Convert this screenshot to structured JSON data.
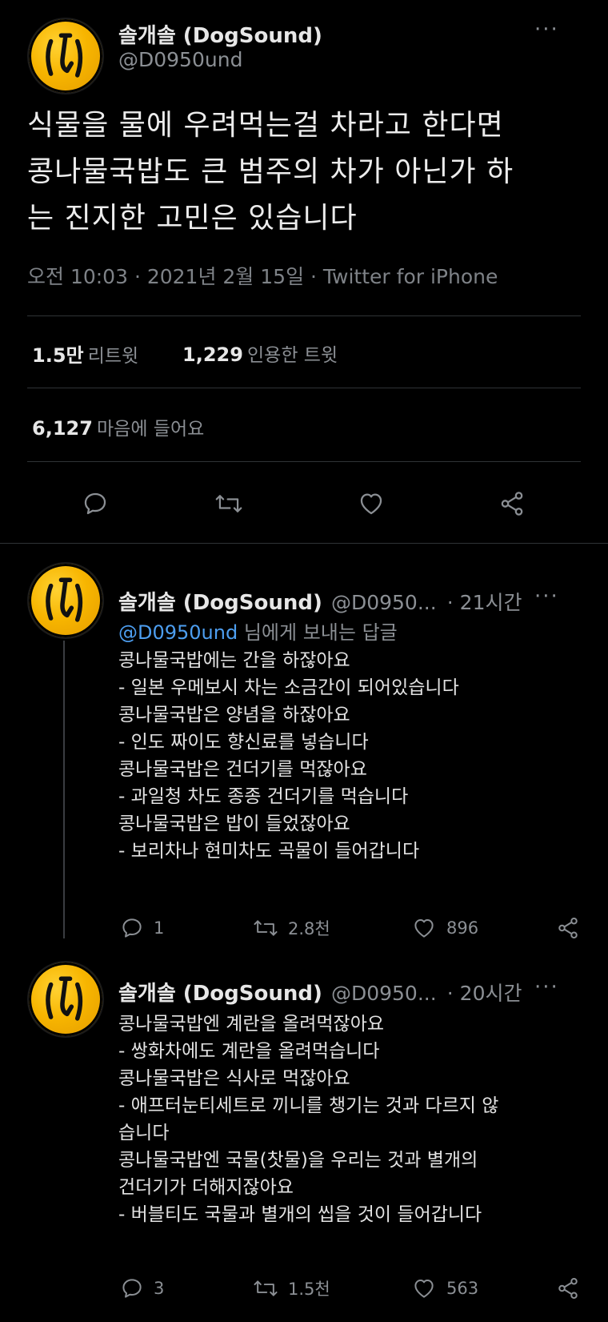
{
  "main_tweet": {
    "display_name": "솔개솔 (DogSound)",
    "handle": "@D0950und",
    "more": "···",
    "text_lines": [
      "식물을 물에 우려먹는걸 차라고 한다면",
      "콩나물국밥도 큰 범주의 차가 아닌가 하",
      "는 진지한 고민은 있습니다"
    ],
    "timestamp": "오전 10:03 · 2021년 2월 15일 · Twitter for iPhone",
    "stats": {
      "retweets_num": "1.5만",
      "retweets_label": "리트윗",
      "quotes_num": "1,229",
      "quotes_label": "인용한 트윗",
      "likes_num": "6,127",
      "likes_label": "마음에 들어요"
    }
  },
  "replies": [
    {
      "display_name": "솔개솔 (DogSound)",
      "handle": "@D0950...",
      "time": "· 21시간",
      "more": "···",
      "reply_to_handle": "@D0950und",
      "reply_to_suffix": " 님에게 보내는 답글",
      "lines": [
        "콩나물국밥에는 간을 하잖아요",
        "- 일본 우메보시 차는 소금간이 되어있습니다",
        "콩나물국밥은 양념을 하잖아요",
        "- 인도 짜이도 향신료를 넣습니다",
        "콩나물국밥은 건더기를 먹잖아요",
        "- 과일청 차도 종종 건더기를 먹습니다",
        "콩나물국밥은 밥이 들었잖아요",
        "- 보리차나 현미차도 곡물이 들어갑니다"
      ],
      "replies_count": "1",
      "retweets_count": "2.8천",
      "likes_count": "896"
    },
    {
      "display_name": "솔개솔 (DogSound)",
      "handle": "@D0950...",
      "time": "· 20시간",
      "more": "···",
      "lines": [
        "콩나물국밥엔 계란을 올려먹잖아요",
        "- 쌍화차에도 계란을 올려먹습니다",
        "콩나물국밥은 식사로 먹잖아요",
        "- 애프터눈티세트로 끼니를 챙기는 것과 다르지 않",
        "습니다",
        "콩나물국밥엔 국물(찻물)을 우리는 것과 별개의",
        "건더기가 더해지잖아요",
        "- 버블티도 국물과 별개의 씹을 것이 들어갑니다"
      ],
      "replies_count": "3",
      "retweets_count": "1.5천",
      "likes_count": "563"
    }
  ],
  "icons": {
    "reply": "speech-bubble-icon",
    "retweet": "retweet-icon",
    "like": "heart-icon",
    "share": "share-icon",
    "avatar": "avatar-logo"
  },
  "colors": {
    "background": "#000000",
    "link_blue": "#4d9ef0",
    "avatar_yellow": "#f7b500",
    "muted": "#8b8f94"
  }
}
